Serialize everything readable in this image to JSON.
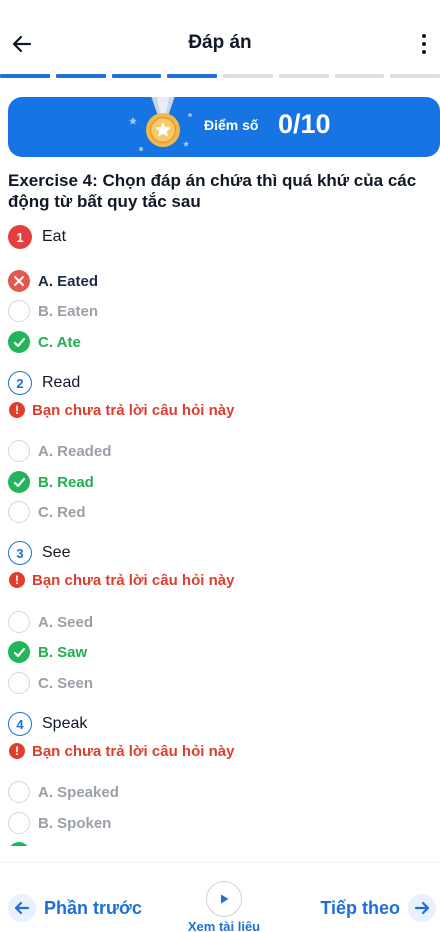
{
  "header": {
    "title": "Đáp án",
    "back_icon": "arrow-left-icon",
    "more_icon": "more-vertical-icon"
  },
  "progress": {
    "total_segments": 8,
    "completed_segments": 4,
    "accent": "#1e6fd9",
    "track": "#dde1e7"
  },
  "score": {
    "label": "Điểm số",
    "value": "0/10",
    "banner_color": "#1774e3",
    "icon": "medal-icon"
  },
  "exercise_title": "Exercise 4: Chọn đáp án chứa thì quá khứ của các động từ bất quy tắc sau",
  "questions": [
    {
      "number": "1",
      "word": "Eat",
      "status": "wrong",
      "options": [
        {
          "label": "A. Eated",
          "state": "wrong"
        },
        {
          "label": "B. Eaten",
          "state": "unselected"
        },
        {
          "label": "C. Ate",
          "state": "correct"
        }
      ]
    },
    {
      "number": "2",
      "word": "Read",
      "status": "unanswered",
      "notice": "Bạn chưa trả lời câu hỏi này",
      "options": [
        {
          "label": "A. Readed",
          "state": "unselected"
        },
        {
          "label": "B. Read",
          "state": "correct"
        },
        {
          "label": "C. Red",
          "state": "unselected"
        }
      ]
    },
    {
      "number": "3",
      "word": "See",
      "status": "unanswered",
      "notice": "Bạn chưa trả lời câu hỏi này",
      "options": [
        {
          "label": "A. Seed",
          "state": "unselected"
        },
        {
          "label": "B. Saw",
          "state": "correct"
        },
        {
          "label": "C. Seen",
          "state": "unselected"
        }
      ]
    },
    {
      "number": "4",
      "word": "Speak",
      "status": "unanswered",
      "notice": "Bạn chưa trả lời câu hỏi này",
      "options": [
        {
          "label": "A. Speaked",
          "state": "unselected"
        },
        {
          "label": "B. Spoken",
          "state": "unselected"
        }
      ]
    }
  ],
  "footer": {
    "prev_label": "Phần trước",
    "next_label": "Tiếp theo",
    "doc_label": "Xem tài liệu",
    "prev_icon": "arrow-left-icon",
    "next_icon": "arrow-right-icon",
    "doc_icon": "play-icon"
  },
  "colors": {
    "correct": "#22b04f",
    "wrong": "#e5564e",
    "notice": "#e03e2d",
    "muted": "#9aa0a8"
  }
}
